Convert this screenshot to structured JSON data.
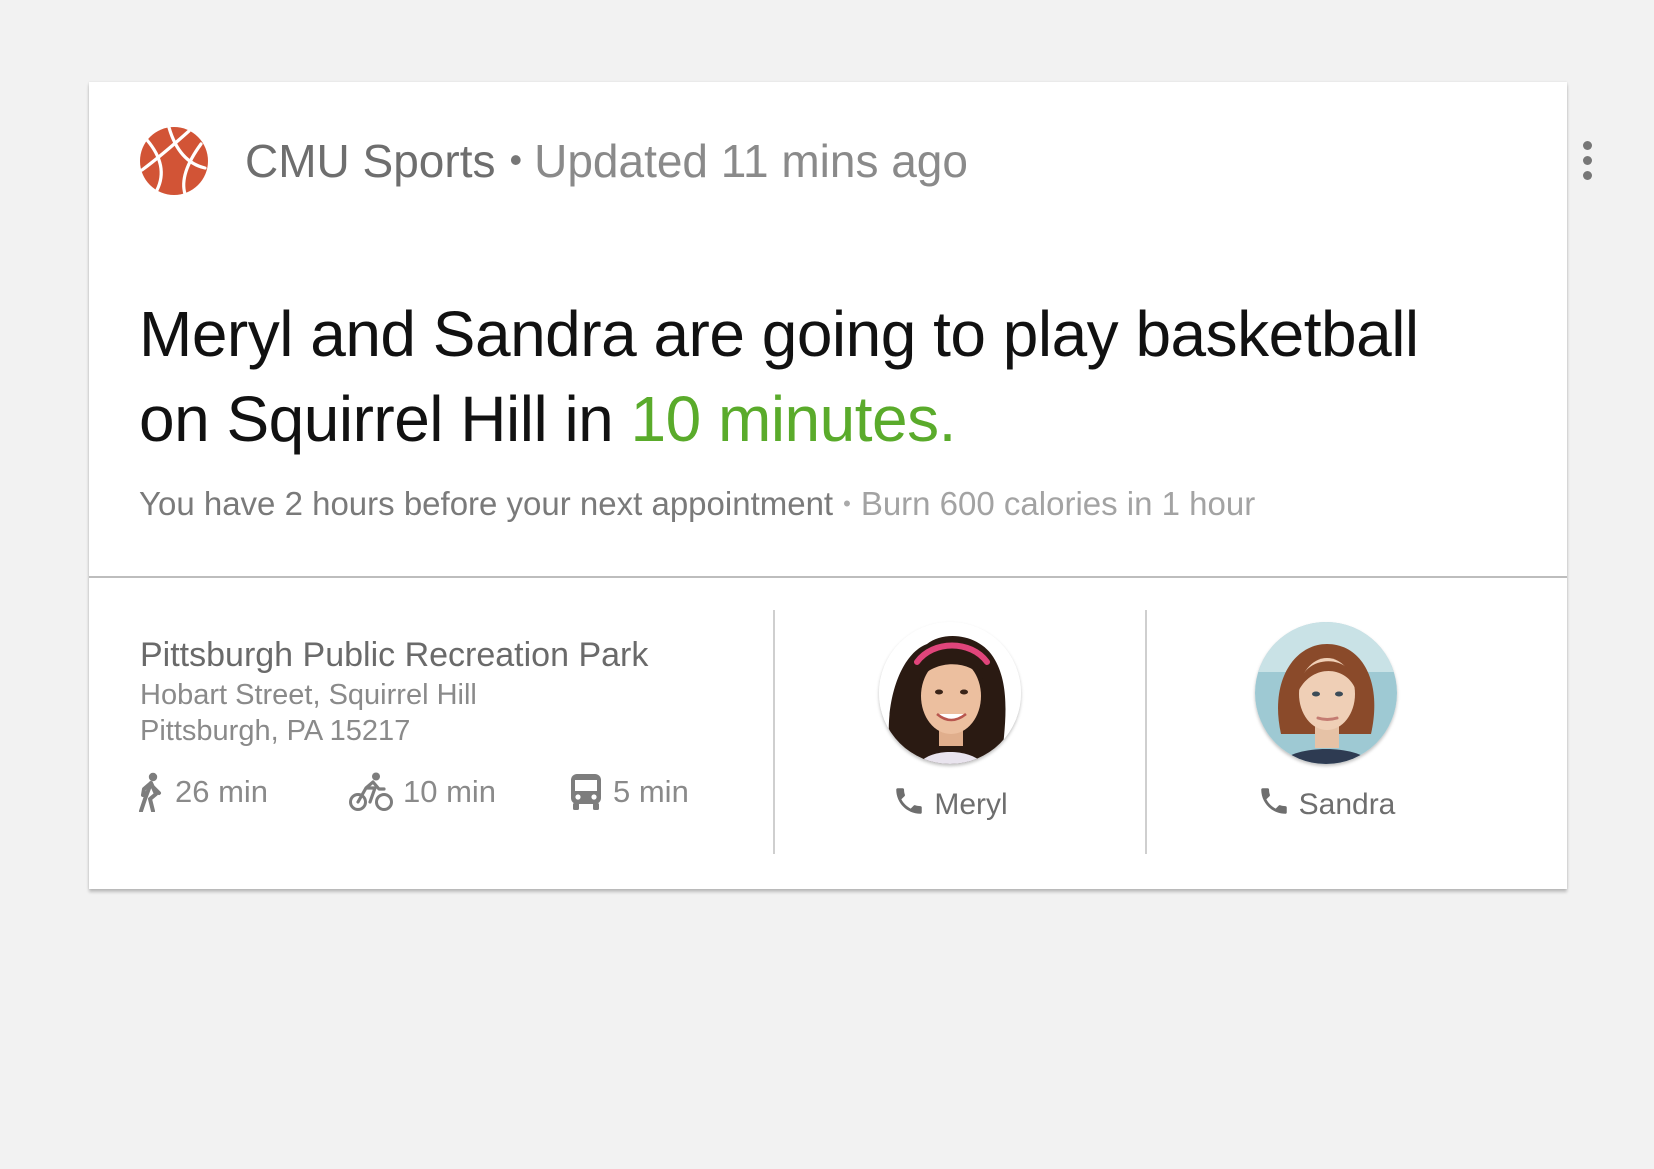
{
  "card": {
    "source_name": "CMU Sports",
    "separator": "•",
    "updated": "Updated 11 mins ago",
    "headline_main": "Meryl and Sandra are going to play basketball on Squirrel Hill in ",
    "headline_highlight": "10 minutes.",
    "subline_primary": "You have 2 hours before your next appointment",
    "subline_separator": "•",
    "subline_secondary": "Burn 600 calories in 1 hour",
    "icons": {
      "source": "basketball-icon",
      "menu": "more-vert-icon",
      "walk": "walk-icon",
      "bike": "bike-icon",
      "bus": "bus-icon",
      "phone": "phone-icon"
    },
    "colors": {
      "basketball": "#d25436",
      "highlight": "#5aab2b"
    }
  },
  "location": {
    "name": "Pittsburgh Public Recreation Park",
    "address_line1": "Hobart Street, Squirrel Hill",
    "address_line2": "Pittsburgh, PA 15217"
  },
  "travel": {
    "walk": "26 min",
    "bike": "10 min",
    "bus": "5 min"
  },
  "contacts": [
    {
      "name": "Meryl"
    },
    {
      "name": "Sandra"
    }
  ]
}
